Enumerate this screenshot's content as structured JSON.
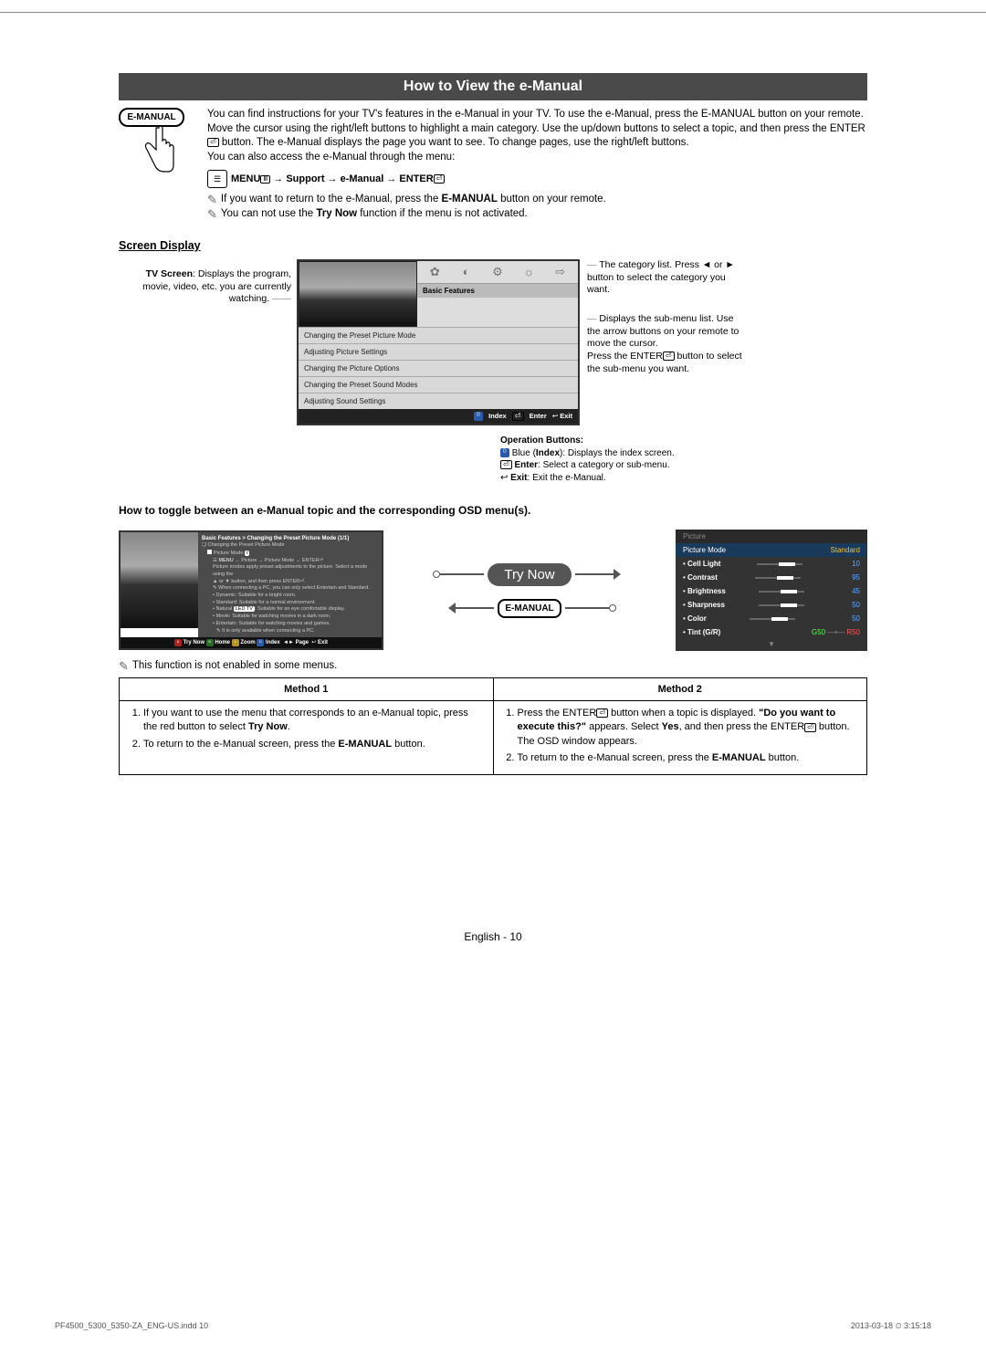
{
  "title": "How to View the e-Manual",
  "emanual_label": "E-MANUAL",
  "intro": {
    "p1": "You can find instructions for your TV's features in the e-Manual in your TV. To use the e-Manual, press the E-MANUAL button on your remote. Move the cursor using the right/left buttons to highlight a main category. Use the up/down buttons to select a topic, and then press the ENTER",
    "p1_cont": " button. The e-Manual displays the page you want to see. To change pages, use the right/left buttons.",
    "p2": "You can also access the e-Manual through the menu:",
    "path_menu": "MENU",
    "path_arrow1": " → Support → e-Manual → ENTER",
    "note1_pre": "If you want to return to the e-Manual, press the ",
    "note1_bold": "E-MANUAL",
    "note1_post": " button on your remote.",
    "note2_pre": "You can not use the ",
    "note2_bold": "Try Now",
    "note2_post": " function if the menu is not activated."
  },
  "screen_display_heading": "Screen Display",
  "sd_left": {
    "bold": "TV Screen",
    "text": ": Displays the program, movie, video, etc. you are currently watching."
  },
  "sd_ui": {
    "category_label": "Basic Features",
    "rows": [
      "Changing the Preset Picture Mode",
      "Adjusting Picture Settings",
      "Changing the Picture Options",
      "Changing the Preset Sound Modes",
      "Adjusting Sound Settings"
    ],
    "footer_index": "Index",
    "footer_enter": "Enter",
    "footer_exit": "Exit"
  },
  "sd_right": {
    "c1": "The category list. Press ◄ or ► button to select the category you want.",
    "c2": "Displays the sub-menu list. Use the arrow buttons on your remote to move the cursor.",
    "c2b": "Press the ENTER",
    "c2c": " button to select the sub-menu you want."
  },
  "op_buttons": {
    "heading": "Operation Buttons:",
    "l1a": " Blue (",
    "l1b": "Index",
    "l1c": "): Displays the index screen.",
    "l2a": "Enter",
    "l2b": ": Select a category or sub-menu.",
    "l3a": "Exit",
    "l3b": ": Exit the e-Manual."
  },
  "toggle_heading": "How to toggle between an e-Manual topic and the corresponding OSD menu(s).",
  "tg_left": {
    "breadcrumb": "Basic Features > Changing the Preset Picture Mode (1/1)",
    "h": "Changing the Preset Picture Mode",
    "pm_label": "Picture Mode",
    "pm_path_a": "MENU",
    "pm_path_b": " → Picture → Picture Mode → ENTER",
    "desc1": "Picture modes apply preset adjustments to the picture. Select a mode using the",
    "desc2": "▲ or ▼ button, and then press ENTER",
    "note_pc": "When connecting a PC, you can only select Entertain and Standard.",
    "b1": "Dynamic: Suitable for a bright room.",
    "b2": "Standard: Suitable for a normal environment.",
    "b3a": "Natural ",
    "b3b": ": Suitable for an eye comfortable display.",
    "b4": "Movie: Suitable for watching movies in a dark room.",
    "b5": "Entertain: Suitable for watching movies and games.",
    "note_pc2": "It is only available when connecting a PC.",
    "footer": " Try Now   Home   Zoom   Index  ◄► Page  ↩ Exit",
    "f_try": "Try Now",
    "f_home": "Home",
    "f_zoom": "Zoom",
    "f_idx": "Index",
    "f_page": "Page",
    "f_exit": "Exit"
  },
  "trynow_label": "Try Now",
  "tg_right": {
    "header": "Picture",
    "sel_label": "Picture Mode",
    "sel_value": "Standard",
    "rows": [
      {
        "label": "Cell Light",
        "value": "10"
      },
      {
        "label": "Contrast",
        "value": "95"
      },
      {
        "label": "Brightness",
        "value": "45"
      },
      {
        "label": "Sharpness",
        "value": "50"
      },
      {
        "label": "Color",
        "value": "50"
      }
    ],
    "tint_label": "Tint (G/R)",
    "tint_g": "G50",
    "tint_r": "R50"
  },
  "note3": "This function is not enabled in some menus.",
  "methods": {
    "h1": "Method 1",
    "h2": "Method 2",
    "m1_1a": "If you want to use the menu that corresponds to an e-Manual topic, press the red button to select ",
    "m1_1b": "Try Now",
    "m1_1c": ".",
    "m1_2a": "To return to the e-Manual screen, press the ",
    "m1_2b": "E-MANUAL",
    "m1_2c": " button.",
    "m2_1a": "Press the ENTER",
    "m2_1b": " button when a topic is displayed. ",
    "m2_1c": "\"Do you want to execute this?\"",
    "m2_1d": " appears. Select ",
    "m2_1e": "Yes",
    "m2_1f": ", and then press the ENTER",
    "m2_1g": " button. The OSD window appears.",
    "m2_2a": "To return to the e-Manual screen, press the ",
    "m2_2b": "E-MANUAL",
    "m2_2c": " button."
  },
  "page_footer": "English - 10",
  "meta_left": "PF4500_5300_5350-ZA_ENG-US.indd   10",
  "meta_right": "2013-03-18   ⏲ 3:15:18"
}
